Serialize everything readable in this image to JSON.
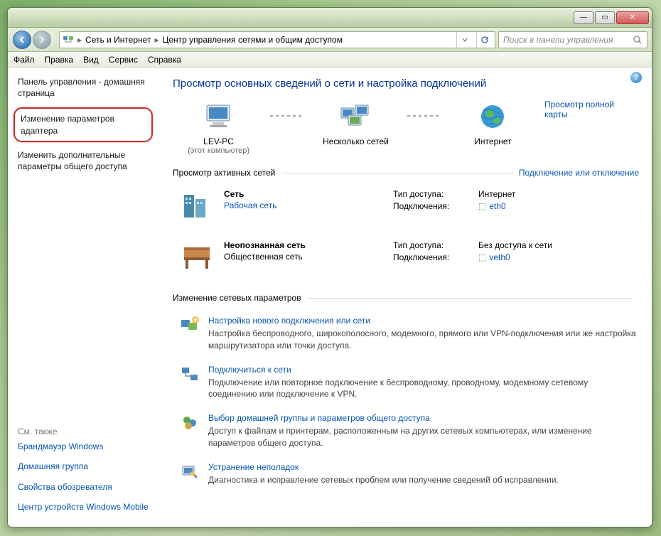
{
  "breadcrumb": {
    "part1": "Сеть и Интернет",
    "part2": "Центр управления сетями и общим доступом"
  },
  "search": {
    "placeholder": "Поиск в панели управления"
  },
  "menu": {
    "file": "Файл",
    "edit": "Правка",
    "view": "Вид",
    "tools": "Сервис",
    "help": "Справка"
  },
  "sidebar": {
    "home": "Панель управления - домашняя страница",
    "adapter": "Изменение параметров адаптера",
    "sharing": "Изменить дополнительные параметры общего доступа",
    "also_h": "См. также",
    "also": [
      "Брандмауэр Windows",
      "Домашняя группа",
      "Свойства обозревателя",
      "Центр устройств Windows Mobile"
    ]
  },
  "content": {
    "h1": "Просмотр основных сведений о сети и настройка подключений",
    "map": {
      "n1": "LEV-PC",
      "n1s": "(этот компьютер)",
      "n2": "Несколько сетей",
      "n3": "Интернет",
      "full_link": "Просмотр полной карты"
    },
    "sec1": {
      "title": "Просмотр активных сетей",
      "link": "Подключение или отключение"
    },
    "nets": [
      {
        "name": "Сеть",
        "type_link": "Рабочая сеть",
        "access_lbl": "Тип доступа:",
        "access_val": "Интернет",
        "conn_lbl": "Подключения:",
        "conn_link": "eth0"
      },
      {
        "name": "Неопознанная сеть",
        "type_text": "Общественная сеть",
        "access_lbl": "Тип доступа:",
        "access_val": "Без доступа к сети",
        "conn_lbl": "Подключения:",
        "conn_link": "veth0"
      }
    ],
    "sec2": {
      "title": "Изменение сетевых параметров"
    },
    "opts": [
      {
        "t": "Настройка нового подключения или сети",
        "d": "Настройка беспроводного, широкополосного, модемного, прямого или VPN-подключения или же настройка маршрутизатора или точки доступа."
      },
      {
        "t": "Подключиться к сети",
        "d": "Подключение или повторное подключение к беспроводному, проводному, модемному сетевому соединению или подключение к VPN."
      },
      {
        "t": "Выбор домашней группы и параметров общего доступа",
        "d": "Доступ к файлам и принтерам, расположенным на других сетевых компьютерах, или изменение параметров общего доступа."
      },
      {
        "t": "Устранение неполадок",
        "d": "Диагностика и исправление сетевых проблем или получение сведений об исправлении."
      }
    ]
  }
}
